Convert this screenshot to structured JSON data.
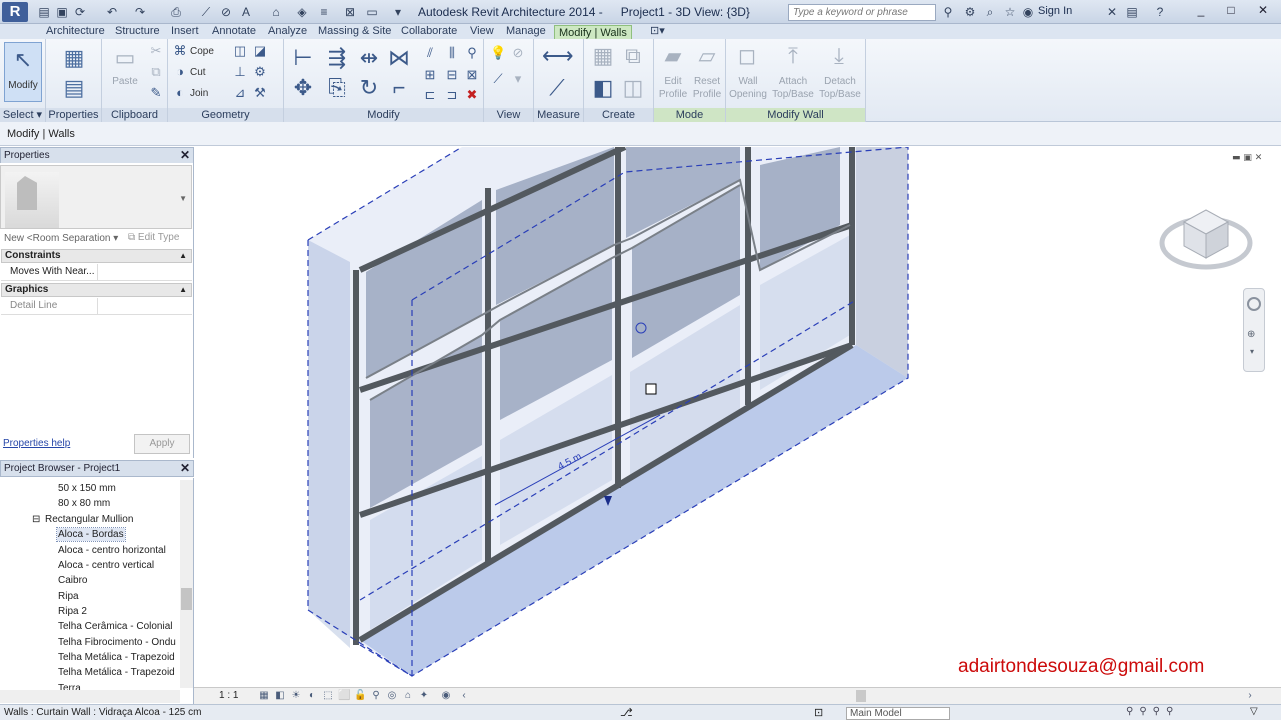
{
  "title_bar": {
    "app_title": "Autodesk Revit Architecture 2014 -",
    "doc_title": "Project1 - 3D View: {3D}",
    "search_placeholder": "Type a keyword or phrase",
    "sign_in": "Sign In"
  },
  "ribbon_tabs": [
    "Architecture",
    "Structure",
    "Insert",
    "Annotate",
    "Analyze",
    "Massing & Site",
    "Collaborate",
    "View",
    "Manage",
    "Modify | Walls"
  ],
  "ribbon": {
    "select": {
      "modify": "Modify",
      "label": "Select"
    },
    "properties": {
      "label": "Properties"
    },
    "clipboard": {
      "paste": "Paste",
      "label": "Clipboard"
    },
    "geometry": {
      "cope": "Cope",
      "cut": "Cut",
      "join": "Join",
      "label": "Geometry"
    },
    "modify_label": "Modify",
    "view_label": "View",
    "measure_label": "Measure",
    "create_label": "Create",
    "mode": {
      "edit_profile": "Edit Profile",
      "reset_profile": "Reset Profile",
      "label": "Mode"
    },
    "modify_wall": {
      "wall_opening": "Wall Opening",
      "attach": "Attach Top/Base",
      "detach": "Detach Top/Base",
      "label": "Modify Wall"
    }
  },
  "options_bar": {
    "text": "Modify | Walls"
  },
  "properties_palette": {
    "title": "Properties",
    "instance_filter": "New <Room Separation",
    "edit_type": "Edit Type",
    "categories": [
      {
        "name": "Constraints",
        "rows": [
          {
            "key": "Moves With Near...",
            "value": ""
          }
        ]
      },
      {
        "name": "Graphics",
        "rows": [
          {
            "key": "Detail Line",
            "value": ""
          }
        ]
      }
    ],
    "help_link": "Properties help",
    "apply": "Apply"
  },
  "project_browser": {
    "title": "Project Browser - Project1",
    "items": [
      {
        "label": "50 x 150 mm",
        "indent": 3
      },
      {
        "label": "80 x 80 mm",
        "indent": 3
      },
      {
        "label": "Rectangular Mullion",
        "indent": 2,
        "expander": "⊟"
      },
      {
        "label": "Aloca - Bordas",
        "indent": 3,
        "selected": true
      },
      {
        "label": "Aloca - centro horizontal",
        "indent": 3
      },
      {
        "label": "Aloca - centro vertical",
        "indent": 3
      },
      {
        "label": "Caibro",
        "indent": 3
      },
      {
        "label": "Ripa",
        "indent": 3
      },
      {
        "label": "Ripa 2",
        "indent": 3
      },
      {
        "label": "Telha Cerâmica - Colonial",
        "indent": 3
      },
      {
        "label": "Telha Fibrocimento - Ondu",
        "indent": 3
      },
      {
        "label": "Telha Metálica - Trapezoid",
        "indent": 3
      },
      {
        "label": "Telha Metálica - Trapezoid",
        "indent": 3
      },
      {
        "label": "Terra",
        "indent": 3
      }
    ]
  },
  "viewport": {
    "dimension": "4.5 m"
  },
  "view_control": {
    "scale": "1 : 1"
  },
  "status_bar": {
    "text": "Walls : Curtain Wall : Vidraça Alcoa - 125 cm",
    "model": "Main Model"
  },
  "watermark": "adairtondesouza@gmail.com"
}
